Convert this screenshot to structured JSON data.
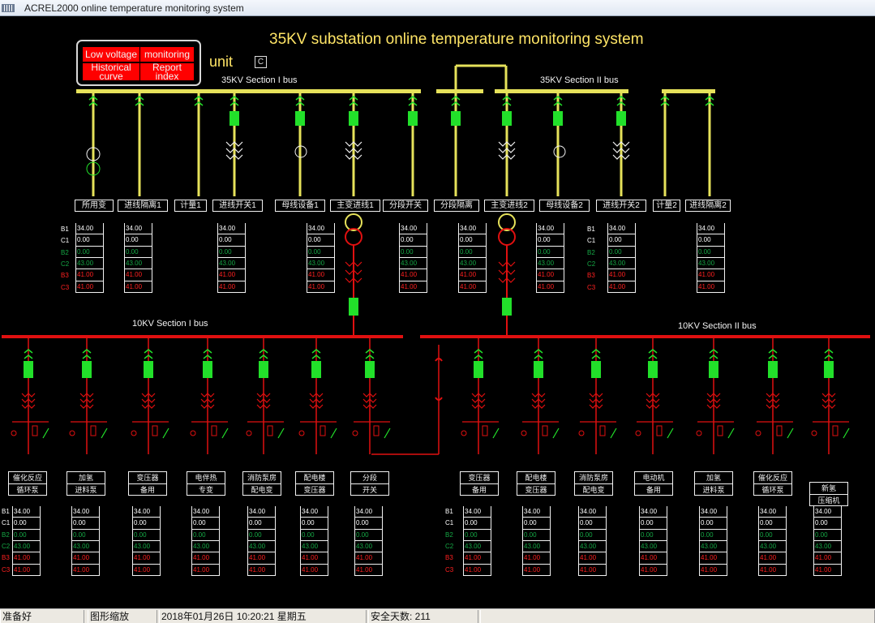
{
  "window": {
    "title": "ACREL2000 online temperature monitoring system"
  },
  "header": {
    "title": "35KV substation online temperature monitoring system",
    "unit_label": "unit",
    "unit_value": "C"
  },
  "menu": {
    "low_voltage": "Low voltage monitoring",
    "historical": "Historical curve",
    "report": "Report index"
  },
  "buses": {
    "hv1": "35KV Section I bus",
    "hv2": "35KV Section II bus",
    "lv1": "10KV Section I bus",
    "lv2": "10KV Section II bus"
  },
  "phases": [
    "B1",
    "C1",
    "B2",
    "C2",
    "B3",
    "C3"
  ],
  "top_feeders": [
    "所用变",
    "进线隔离1",
    "计量1",
    "进线开关1",
    "母线设备1",
    "主变进线1",
    "分段开关",
    "分段隔离",
    "主变进线2",
    "母线设备2",
    "进线开关2",
    "计量2",
    "进线隔离2"
  ],
  "bottom_feeders": [
    [
      "催化反应",
      "循环泵"
    ],
    [
      "加氢",
      "进料泵"
    ],
    [
      "变压器",
      "备用"
    ],
    [
      "电伴热",
      "专变"
    ],
    [
      "消防泵房",
      "配电变"
    ],
    [
      "配电楼",
      "变压器"
    ],
    [
      "分段",
      "开关"
    ],
    [
      "变压器",
      "备用"
    ],
    [
      "配电楼",
      "变压器"
    ],
    [
      "消防泵房",
      "配电变"
    ],
    [
      "电动机",
      "备用"
    ],
    [
      "加氢",
      "进料泵"
    ],
    [
      "催化反应",
      "循环泵"
    ],
    [
      "新氢",
      "压缩机"
    ]
  ],
  "readings": [
    "34.00",
    "0.00",
    "0.00",
    "43.00",
    "41.00",
    "41.00"
  ],
  "status": {
    "ready": "准备好",
    "zoom": "图形缩放",
    "datetime": "2018年01月26日   10:20:21   星期五",
    "safe_days": "安全天数: 211"
  },
  "colors": {
    "bus_hv": "#e6e25a",
    "bus_lv": "#e01010",
    "breaker": "#22e02a",
    "ct": "#f2f2f2"
  }
}
